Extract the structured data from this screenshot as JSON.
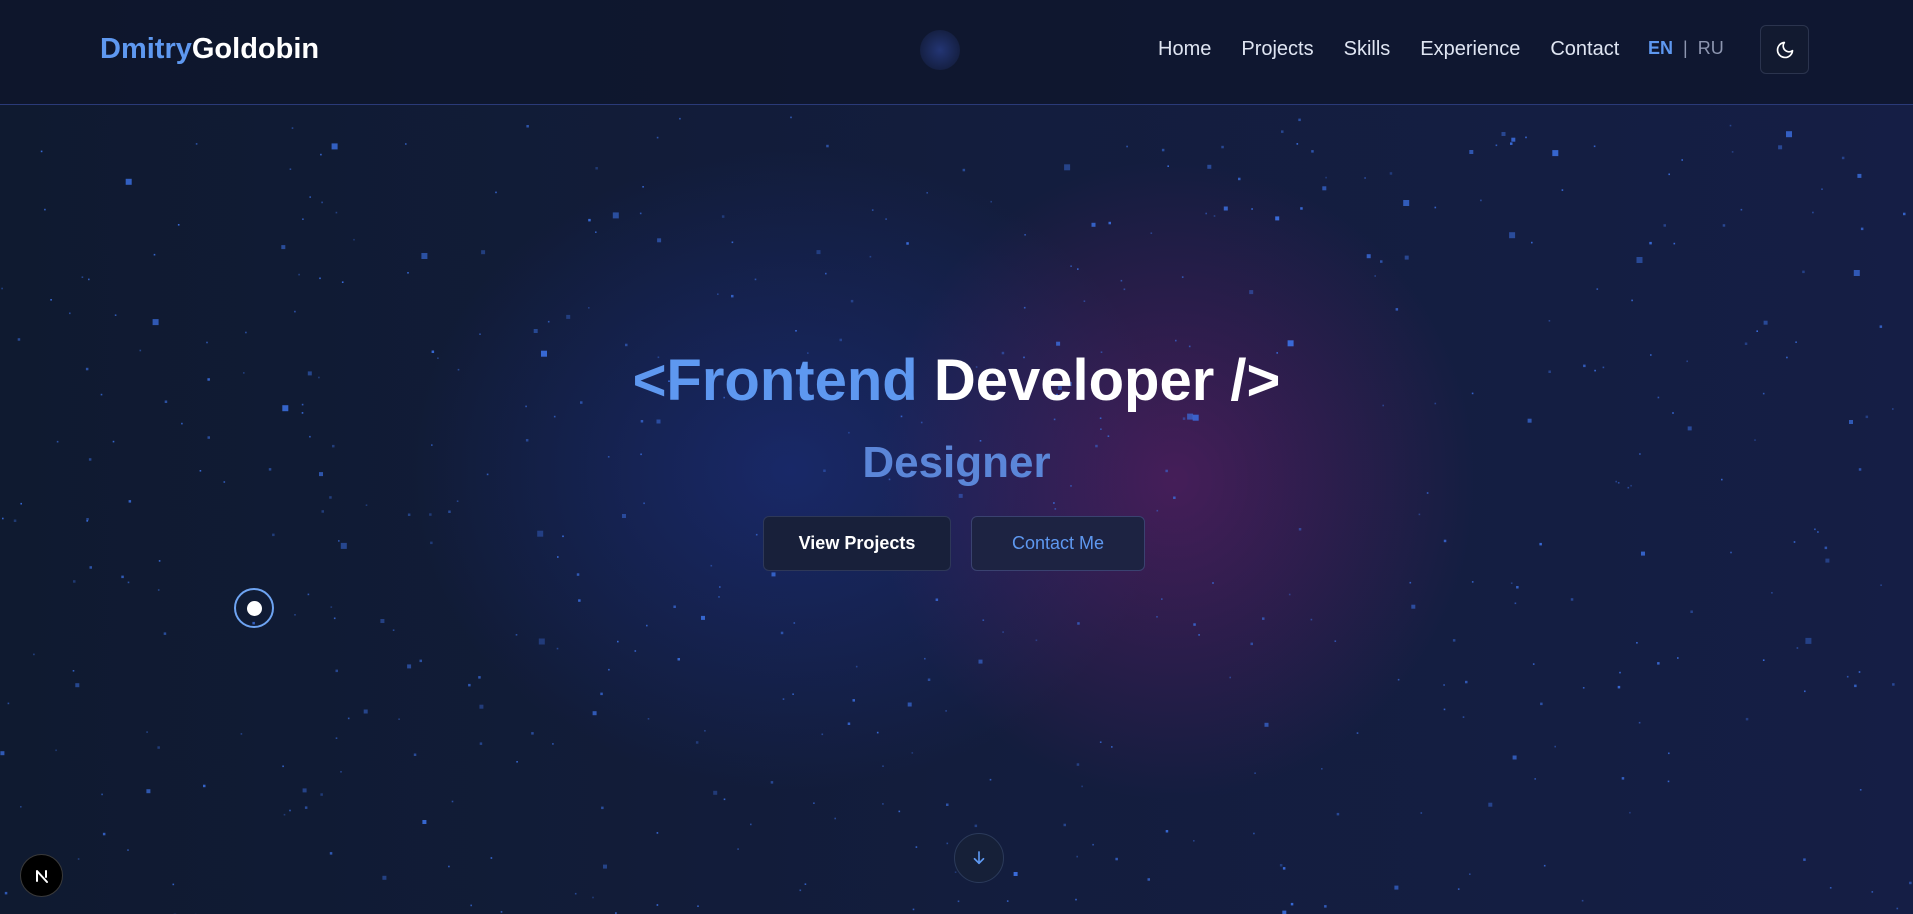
{
  "header": {
    "logo_first": "Dmitry",
    "logo_last": "Goldobin",
    "nav": [
      "Home",
      "Projects",
      "Skills",
      "Experience",
      "Contact"
    ],
    "lang_active": "EN",
    "lang_separator": "|",
    "lang_inactive": "RU",
    "theme_icon": "moon-icon"
  },
  "hero": {
    "title_open": "<Frontend",
    "title_rest": "Developer />",
    "subtitle": "Designer",
    "primary_button": "View Projects",
    "secondary_button": "Contact Me",
    "scroll_icon": "arrow-down-icon"
  },
  "badge_icon": "nextjs-icon",
  "colors": {
    "accent": "#5e98f0",
    "background": "#101a33",
    "star": "#3b6fe0"
  }
}
